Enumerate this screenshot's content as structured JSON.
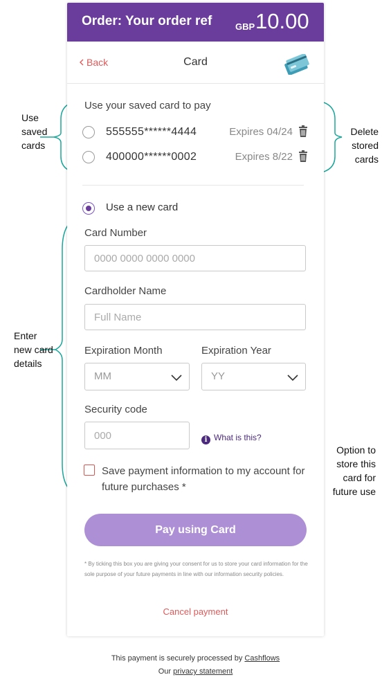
{
  "header": {
    "order_title": "Order: Your order ref",
    "currency": "GBP",
    "amount": "10.00"
  },
  "subbar": {
    "back_label": "Back",
    "title": "Card",
    "card_icon": "credit-card-icon"
  },
  "saved_cards": {
    "heading": "Use your saved card to pay",
    "items": [
      {
        "number": "555555******4444",
        "expires": "Expires 04/24"
      },
      {
        "number": "400000******0002",
        "expires": "Expires 8/22"
      }
    ]
  },
  "new_card": {
    "option_label": "Use a new card",
    "card_number_label": "Card Number",
    "card_number_placeholder": "0000 0000 0000 0000",
    "cardholder_label": "Cardholder Name",
    "cardholder_placeholder": "Full Name",
    "exp_month_label": "Expiration Month",
    "exp_month_value": "MM",
    "exp_year_label": "Expiration Year",
    "exp_year_value": "YY",
    "security_label": "Security code",
    "security_placeholder": "000",
    "what_is_this": "What is this?",
    "save_info": "Save payment information to my account for future purchases *"
  },
  "pay_button": "Pay using Card",
  "consent_text": "* By ticking this box you are giving your consent for us to store your card information for the sole purpose of your future payments in line with our information security policies.",
  "cancel": "Cancel payment",
  "footer": {
    "processed_prefix": "This payment is securely processed by ",
    "processor": "Cashflows",
    "privacy_prefix": "Our ",
    "privacy_link": "privacy statement"
  },
  "annotations": {
    "saved_l1": "Use",
    "saved_l2": "saved",
    "saved_l3": "cards",
    "delete_l1": "Delete",
    "delete_l2": "stored",
    "delete_l3": "cards",
    "new_l1": "Enter",
    "new_l2": "new card",
    "new_l3": "details",
    "opt_l1": "Option to",
    "opt_l2": "store this",
    "opt_l3": "card for",
    "opt_l4": "future use"
  },
  "colors": {
    "brand": "#6a3d9c",
    "pay_button": "#ad8fd6",
    "accent_red": "#e05a5a",
    "annotation_teal": "#1aa59a"
  }
}
